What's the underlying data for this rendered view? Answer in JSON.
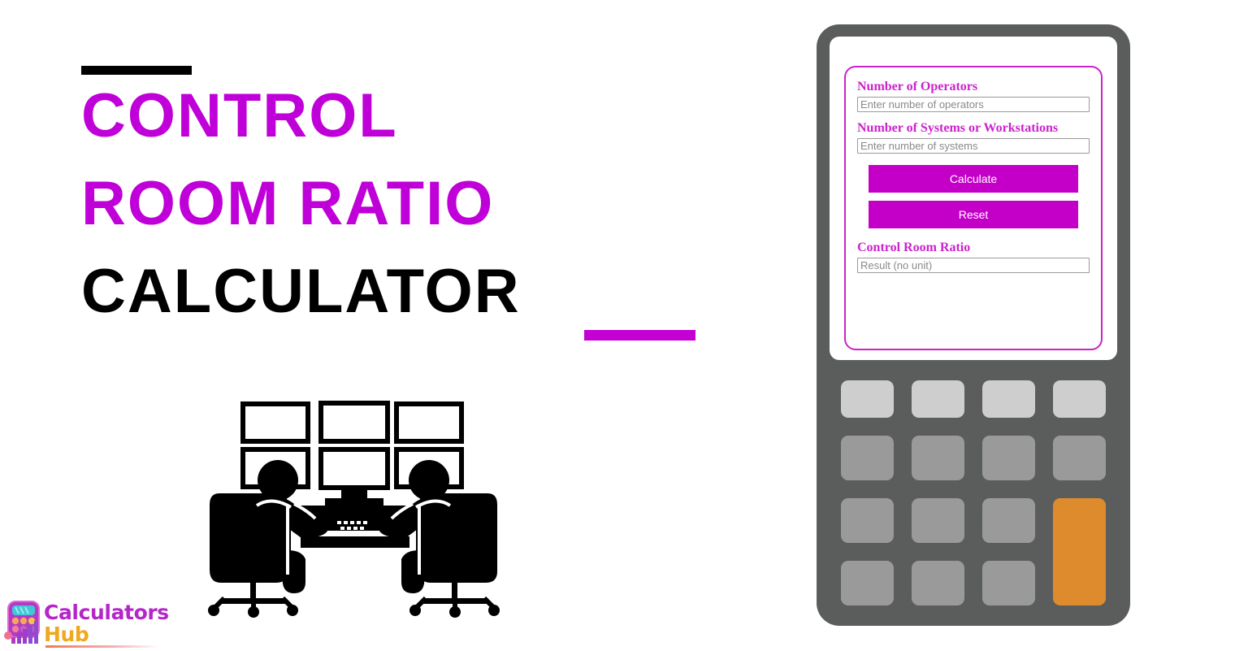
{
  "page": {
    "background": "#ffffff",
    "accent_magenta": "#c000d8",
    "accent_orange": "#de8b2e"
  },
  "title": {
    "line1": "CONTROL",
    "line2": "ROOM RATIO",
    "line3": "CALCULATOR",
    "top_rule": "black-rule",
    "bottom_rule": "magenta-rule"
  },
  "illustration": {
    "name": "control-room-operators-illustration",
    "monitor_rows": 2,
    "monitor_columns": 3,
    "operators": 2
  },
  "logo": {
    "word1": "Calculators",
    "word2": "Hub",
    "icon": "calculator-bar-chart-icon",
    "word1_color": "#b526c8",
    "word2_color": "#f0a81e"
  },
  "calculator": {
    "body_color": "#5b5d5d",
    "screen_color": "#ffffff",
    "form": {
      "border_color": "#cc22cc",
      "fields": [
        {
          "label": "Number of Operators",
          "placeholder": "Enter number of operators",
          "value": ""
        },
        {
          "label": "Number of Systems or Workstations",
          "placeholder": "Enter number of systems",
          "value": ""
        }
      ],
      "buttons": [
        {
          "label": "Calculate"
        },
        {
          "label": "Reset"
        }
      ],
      "result": {
        "label": "Control Room Ratio",
        "placeholder": "Result (no unit)",
        "value": ""
      }
    },
    "keypad": {
      "rows": 4,
      "columns": 4,
      "light_key_color": "#cecece",
      "mid_key_color": "#9a9a9a",
      "accent_key_color": "#de8b2e",
      "accent_key_spans_rows": 2
    }
  }
}
